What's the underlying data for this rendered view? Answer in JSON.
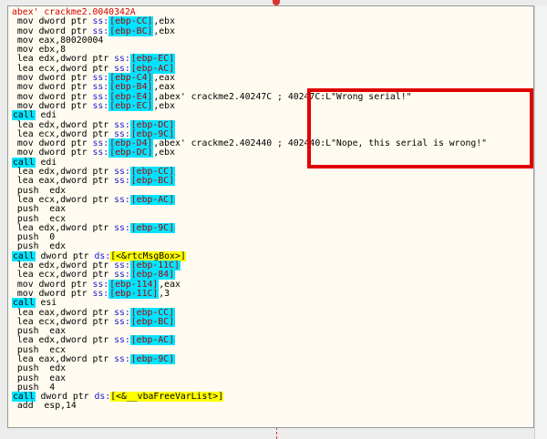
{
  "header": "abex' crackme2.0040342A",
  "lines": [
    {
      "ind": 1,
      "m": "mov",
      "a": "dword ptr ",
      "seg": "ss:",
      "reg": "[ebp-CC]",
      "rest": ",ebx"
    },
    {
      "ind": 1,
      "m": "mov",
      "a": "dword ptr ",
      "seg": "ss:",
      "reg": "[ebp-BC]",
      "rest": ",ebx"
    },
    {
      "ind": 1,
      "m": "mov",
      "a": "eax,80020004",
      "seg": "",
      "reg": "",
      "rest": ""
    },
    {
      "ind": 1,
      "m": "mov",
      "a": "ebx,8",
      "seg": "",
      "reg": "",
      "rest": ""
    },
    {
      "ind": 1,
      "m": "lea",
      "a": "edx,dword ptr ",
      "seg": "ss:",
      "reg": "[ebp-EC]",
      "rest": ""
    },
    {
      "ind": 1,
      "m": "lea",
      "a": "ecx,dword ptr ",
      "seg": "ss:",
      "reg": "[ebp-AC]",
      "rest": ""
    },
    {
      "ind": 1,
      "m": "mov",
      "a": "dword ptr ",
      "seg": "ss:",
      "reg": "[ebp-C4]",
      "rest": ",eax"
    },
    {
      "ind": 1,
      "m": "mov",
      "a": "dword ptr ",
      "seg": "ss:",
      "reg": "[ebp-B4]",
      "rest": ",eax"
    },
    {
      "ind": 1,
      "m": "mov",
      "a": "dword ptr ",
      "seg": "ss:",
      "reg": "[ebp-E4]",
      "rest": ",abex' crackme2.40247C ; 40247C:L\"Wrong serial!\""
    },
    {
      "ind": 1,
      "m": "mov",
      "a": "dword ptr ",
      "seg": "ss:",
      "reg": "[ebp-EC]",
      "rest": ",ebx"
    },
    {
      "ind": 0,
      "m": "call",
      "a": " edi",
      "seg": "",
      "reg": "",
      "rest": "",
      "call": true
    },
    {
      "ind": 1,
      "m": "lea",
      "a": "edx,dword ptr ",
      "seg": "ss:",
      "reg": "[ebp-DC]",
      "rest": ""
    },
    {
      "ind": 1,
      "m": "lea",
      "a": "ecx,dword ptr ",
      "seg": "ss:",
      "reg": "[ebp-9C]",
      "rest": ""
    },
    {
      "ind": 1,
      "m": "mov",
      "a": "dword ptr ",
      "seg": "ss:",
      "reg": "[ebp-D4]",
      "rest": ",abex' crackme2.402440 ; 402440:L\"Nope, this serial is wrong!\""
    },
    {
      "ind": 1,
      "m": "mov",
      "a": "dword ptr ",
      "seg": "ss:",
      "reg": "[ebp-DC]",
      "rest": ",ebx"
    },
    {
      "ind": 0,
      "m": "call",
      "a": " edi",
      "seg": "",
      "reg": "",
      "rest": "",
      "call": true
    },
    {
      "ind": 1,
      "m": "lea",
      "a": "edx,dword ptr ",
      "seg": "ss:",
      "reg": "[ebp-CC]",
      "rest": ""
    },
    {
      "ind": 1,
      "m": "lea",
      "a": "eax,dword ptr ",
      "seg": "ss:",
      "reg": "[ebp-BC]",
      "rest": ""
    },
    {
      "ind": 1,
      "m": "push",
      "a": " edx",
      "seg": "",
      "reg": "",
      "rest": ""
    },
    {
      "ind": 1,
      "m": "lea",
      "a": "ecx,dword ptr ",
      "seg": "ss:",
      "reg": "[ebp-AC]",
      "rest": ""
    },
    {
      "ind": 1,
      "m": "push",
      "a": " eax",
      "seg": "",
      "reg": "",
      "rest": ""
    },
    {
      "ind": 1,
      "m": "push",
      "a": " ecx",
      "seg": "",
      "reg": "",
      "rest": ""
    },
    {
      "ind": 1,
      "m": "lea",
      "a": "edx,dword ptr ",
      "seg": "ss:",
      "reg": "[ebp-9C]",
      "rest": ""
    },
    {
      "ind": 1,
      "m": "push",
      "a": " 0",
      "seg": "",
      "reg": "",
      "rest": ""
    },
    {
      "ind": 1,
      "m": "push",
      "a": " edx",
      "seg": "",
      "reg": "",
      "rest": ""
    },
    {
      "ind": 0,
      "m": "call",
      "a": " dword ptr ",
      "seg": "ds:",
      "reg": "",
      "rest": "",
      "call": true,
      "yl": "[<&rtcMsgBox>]"
    },
    {
      "ind": 1,
      "m": "lea",
      "a": "edx,dword ptr ",
      "seg": "ss:",
      "reg": "[ebp-11C]",
      "rest": ""
    },
    {
      "ind": 1,
      "m": "lea",
      "a": "ecx,dword ptr ",
      "seg": "ss:",
      "reg": "[ebp-84]",
      "rest": ""
    },
    {
      "ind": 1,
      "m": "mov",
      "a": "dword ptr ",
      "seg": "ss:",
      "reg": "[ebp-114]",
      "rest": ",eax"
    },
    {
      "ind": 1,
      "m": "mov",
      "a": "dword ptr ",
      "seg": "ss:",
      "reg": "[ebp-11C]",
      "rest": ",3"
    },
    {
      "ind": 0,
      "m": "call",
      "a": " esi",
      "seg": "",
      "reg": "",
      "rest": "",
      "call": true
    },
    {
      "ind": 1,
      "m": "lea",
      "a": "eax,dword ptr ",
      "seg": "ss:",
      "reg": "[ebp-CC]",
      "rest": ""
    },
    {
      "ind": 1,
      "m": "lea",
      "a": "ecx,dword ptr ",
      "seg": "ss:",
      "reg": "[ebp-BC]",
      "rest": ""
    },
    {
      "ind": 1,
      "m": "push",
      "a": " eax",
      "seg": "",
      "reg": "",
      "rest": ""
    },
    {
      "ind": 1,
      "m": "lea",
      "a": "edx,dword ptr ",
      "seg": "ss:",
      "reg": "[ebp-AC]",
      "rest": ""
    },
    {
      "ind": 1,
      "m": "push",
      "a": " ecx",
      "seg": "",
      "reg": "",
      "rest": ""
    },
    {
      "ind": 1,
      "m": "lea",
      "a": "eax,dword ptr ",
      "seg": "ss:",
      "reg": "[ebp-9C]",
      "rest": ""
    },
    {
      "ind": 1,
      "m": "push",
      "a": " edx",
      "seg": "",
      "reg": "",
      "rest": ""
    },
    {
      "ind": 1,
      "m": "push",
      "a": " eax",
      "seg": "",
      "reg": "",
      "rest": ""
    },
    {
      "ind": 1,
      "m": "push",
      "a": " 4",
      "seg": "",
      "reg": "",
      "rest": ""
    },
    {
      "ind": 0,
      "m": "call",
      "a": " dword ptr ",
      "seg": "ds:",
      "reg": "",
      "rest": "",
      "call": true,
      "yl": "[<&__vbaFreeVarList>]"
    },
    {
      "ind": 1,
      "m": "add",
      "a": " esp,14",
      "seg": "",
      "reg": "",
      "rest": ""
    }
  ],
  "colors": {
    "highlight_box": "#e10000",
    "reg_bg": "#00e4ff",
    "label_bg": "#ffff00"
  }
}
